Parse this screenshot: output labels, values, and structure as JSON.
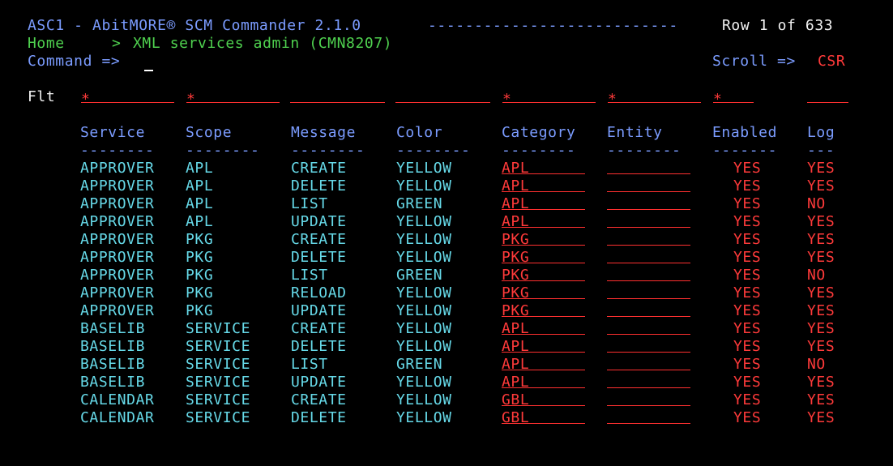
{
  "header": {
    "title": "ASC1 - AbitMORE® SCM Commander 2.1.0",
    "dashes": "---------------------------",
    "row_info": "Row 1 of 633",
    "home": "Home",
    "breadcrumb_arrow": ">",
    "screen_name": "XML services admin (CMN8207)",
    "command_label": "Command =>",
    "scroll_label": "Scroll =>",
    "scroll_value": "CSR"
  },
  "filter": {
    "label": "Flt",
    "service": "*",
    "scope": "*",
    "category": "*",
    "entity": "*",
    "enabled": "*"
  },
  "columns": {
    "service": "Service",
    "scope": "Scope",
    "message": "Message",
    "color": "Color",
    "category": "Category",
    "entity": "Entity",
    "enabled": "Enabled",
    "log": "Log"
  },
  "separators": {
    "service": "--------",
    "scope": "--------",
    "message": "--------",
    "color": "--------",
    "category": "--------",
    "entity": "--------",
    "enabled": "-------",
    "log": "---"
  },
  "rows": [
    {
      "service": "APPROVER",
      "scope": "APL",
      "message": "CREATE",
      "color": "YELLOW",
      "category": "APL",
      "enabled": "YES",
      "log": "YES"
    },
    {
      "service": "APPROVER",
      "scope": "APL",
      "message": "DELETE",
      "color": "YELLOW",
      "category": "APL",
      "enabled": "YES",
      "log": "YES"
    },
    {
      "service": "APPROVER",
      "scope": "APL",
      "message": "LIST",
      "color": "GREEN",
      "category": "APL",
      "enabled": "YES",
      "log": "NO"
    },
    {
      "service": "APPROVER",
      "scope": "APL",
      "message": "UPDATE",
      "color": "YELLOW",
      "category": "APL",
      "enabled": "YES",
      "log": "YES"
    },
    {
      "service": "APPROVER",
      "scope": "PKG",
      "message": "CREATE",
      "color": "YELLOW",
      "category": "PKG",
      "enabled": "YES",
      "log": "YES"
    },
    {
      "service": "APPROVER",
      "scope": "PKG",
      "message": "DELETE",
      "color": "YELLOW",
      "category": "PKG",
      "enabled": "YES",
      "log": "YES"
    },
    {
      "service": "APPROVER",
      "scope": "PKG",
      "message": "LIST",
      "color": "GREEN",
      "category": "PKG",
      "enabled": "YES",
      "log": "NO"
    },
    {
      "service": "APPROVER",
      "scope": "PKG",
      "message": "RELOAD",
      "color": "YELLOW",
      "category": "PKG",
      "enabled": "YES",
      "log": "YES"
    },
    {
      "service": "APPROVER",
      "scope": "PKG",
      "message": "UPDATE",
      "color": "YELLOW",
      "category": "PKG",
      "enabled": "YES",
      "log": "YES"
    },
    {
      "service": "BASELIB",
      "scope": "SERVICE",
      "message": "CREATE",
      "color": "YELLOW",
      "category": "APL",
      "enabled": "YES",
      "log": "YES"
    },
    {
      "service": "BASELIB",
      "scope": "SERVICE",
      "message": "DELETE",
      "color": "YELLOW",
      "category": "APL",
      "enabled": "YES",
      "log": "YES"
    },
    {
      "service": "BASELIB",
      "scope": "SERVICE",
      "message": "LIST",
      "color": "GREEN",
      "category": "APL",
      "enabled": "YES",
      "log": "NO"
    },
    {
      "service": "BASELIB",
      "scope": "SERVICE",
      "message": "UPDATE",
      "color": "YELLOW",
      "category": "APL",
      "enabled": "YES",
      "log": "YES"
    },
    {
      "service": "CALENDAR",
      "scope": "SERVICE",
      "message": "CREATE",
      "color": "YELLOW",
      "category": "GBL",
      "enabled": "YES",
      "log": "YES"
    },
    {
      "service": "CALENDAR",
      "scope": "SERVICE",
      "message": "DELETE",
      "color": "YELLOW",
      "category": "GBL",
      "enabled": "YES",
      "log": "YES"
    }
  ],
  "colors": {
    "background": "#000000",
    "label_blue": "#7b9cff",
    "cyan_data": "#66d9e8",
    "red_input": "#ff3a3a",
    "green_text": "#4fd14f",
    "white_text": "#f2f2f2"
  }
}
